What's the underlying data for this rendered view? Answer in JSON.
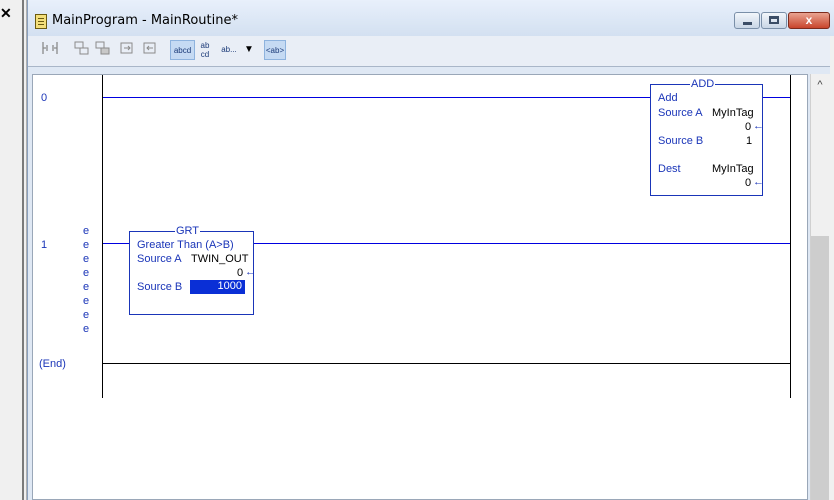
{
  "left_panel": {
    "close_glyph": "✕"
  },
  "window": {
    "title": "MainProgram - MainRoutine*",
    "buttons": {
      "minimize": "",
      "maximize": "",
      "close": "x"
    }
  },
  "toolbar": {
    "items": [
      {
        "icon": "rung-icon"
      },
      {
        "icon": "branch-icon"
      },
      {
        "icon": "branch-level-icon"
      },
      {
        "icon": "xic-icon"
      },
      {
        "icon": "xio-icon"
      }
    ],
    "abcd_label": "abcd",
    "ab_cd_label": "ab\ncd",
    "ab_dots_label": "ab...",
    "ab_angle_label": "<ab>"
  },
  "ladder": {
    "rungs": [
      {
        "number": "0"
      },
      {
        "number": "1",
        "e_marks": [
          "e",
          "e",
          "e",
          "e",
          "e",
          "e",
          "e",
          "e"
        ]
      },
      {
        "number": "(End)"
      }
    ],
    "add_block": {
      "title": "ADD",
      "name": "Add",
      "source_a_label": "Source A",
      "source_a_tag": "MyInTag",
      "source_a_value": "0",
      "source_b_label": "Source B",
      "source_b_value": "1",
      "dest_label": "Dest",
      "dest_tag": "MyInTag",
      "dest_value": "0"
    },
    "grt_block": {
      "title": "GRT",
      "name": "Greater Than (A>B)",
      "source_a_label": "Source A",
      "source_a_tag": "TWIN_OUT",
      "source_a_value": "0",
      "source_b_label": "Source B",
      "source_b_value": "1000"
    },
    "arrow_glyph": "←"
  },
  "scrollbar": {
    "up_glyph": "^"
  }
}
